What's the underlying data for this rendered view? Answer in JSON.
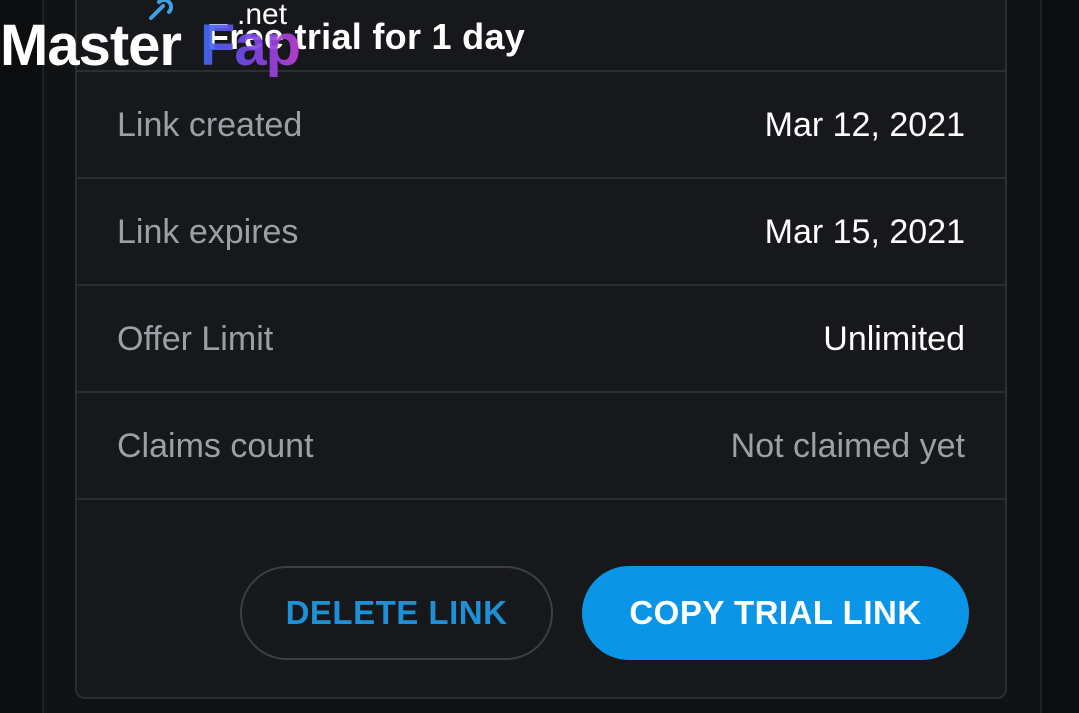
{
  "header": {
    "title": "Free trial for 1 day",
    "icon": "link-icon"
  },
  "details": [
    {
      "label": "Link created",
      "value": "Mar 12, 2021"
    },
    {
      "label": "Link expires",
      "value": "Mar 15, 2021"
    },
    {
      "label": "Offer Limit",
      "value": "Unlimited"
    },
    {
      "label": "Claims count",
      "value": "Not claimed yet"
    }
  ],
  "actions": {
    "delete_label": "DELETE LINK",
    "copy_label": "COPY TRIAL LINK"
  },
  "watermark": {
    "master": "Master",
    "fap": "Fap",
    "net": ".net"
  },
  "colors": {
    "background": "#0c0d0f",
    "card": "#17181b",
    "accent": "#0a95e6",
    "label": "#9aa0a6",
    "value": "#ffffff"
  }
}
